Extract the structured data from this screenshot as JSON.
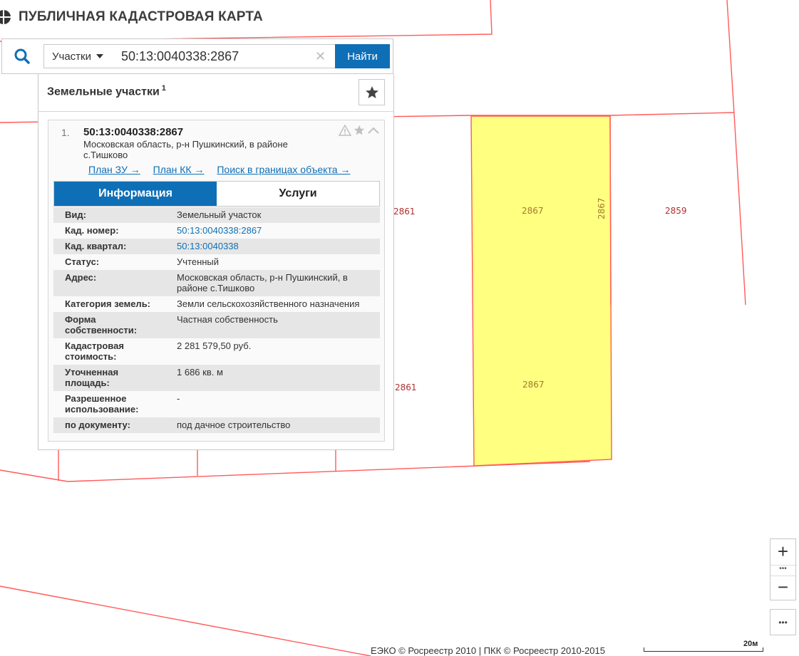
{
  "app": {
    "title": "ПУБЛИЧНАЯ КАДАСТРОВАЯ КАРТА"
  },
  "search": {
    "type_label": "Участки",
    "query": "50:13:0040338:2867",
    "find_label": "Найти"
  },
  "panel": {
    "title": "Земельные участки",
    "count": "1"
  },
  "result": {
    "index": "1.",
    "number": "50:13:0040338:2867",
    "address": "Московская область, р-н Пушкинский, в районе с.Тишково",
    "links": [
      "План ЗУ →",
      "План КК →",
      "Поиск в границах объекта →"
    ]
  },
  "tabs": {
    "info": "Информация",
    "services": "Услуги"
  },
  "info_rows": [
    {
      "label": "Вид:",
      "value": "Земельный участок"
    },
    {
      "label": "Кад. номер:",
      "value": "50:13:0040338:2867"
    },
    {
      "label": "Кад. квартал:",
      "value": "50:13:0040338"
    },
    {
      "label": "Статус:",
      "value": "Учтенный"
    },
    {
      "label": "Адрес:",
      "value": "Московская область, р-н Пушкинский, в районе с.Тишково"
    },
    {
      "label": "Категория земель:",
      "value": "Земли сельскохозяйственного назначения"
    },
    {
      "label": "Форма собственности:",
      "value": "Частная собственность"
    },
    {
      "label": "Кадастровая стоимость:",
      "value": "2 281 579,50 руб."
    },
    {
      "label": "Уточненная площадь:",
      "value": "1 686 кв. м"
    },
    {
      "label": "Разрешенное использование:",
      "value": "-"
    },
    {
      "label": "по документу:",
      "value": "под дачное строительство"
    }
  ],
  "map": {
    "labels": {
      "p2861_top": "2861",
      "p2867_top": "2867",
      "p2867_vertical": "2867",
      "p2859": "2859",
      "p2861_bottom": "2861",
      "p2867_bottom": "2867"
    },
    "colors": {
      "boundary": "#ff5a5a",
      "selected_fill": "#ffff80",
      "label": "#b03030",
      "label_selected": "#a07a30"
    }
  },
  "controls": {
    "zoom_in": "+",
    "zoom_out": "−",
    "dots": "•••",
    "more": "•••"
  },
  "footer": {
    "copyright": "ЕЭКО © Росреестр 2010 | ПКК © Росреестр 2010-2015",
    "scale": "20м"
  },
  "theme": {
    "accent": "#0e6fb6"
  }
}
